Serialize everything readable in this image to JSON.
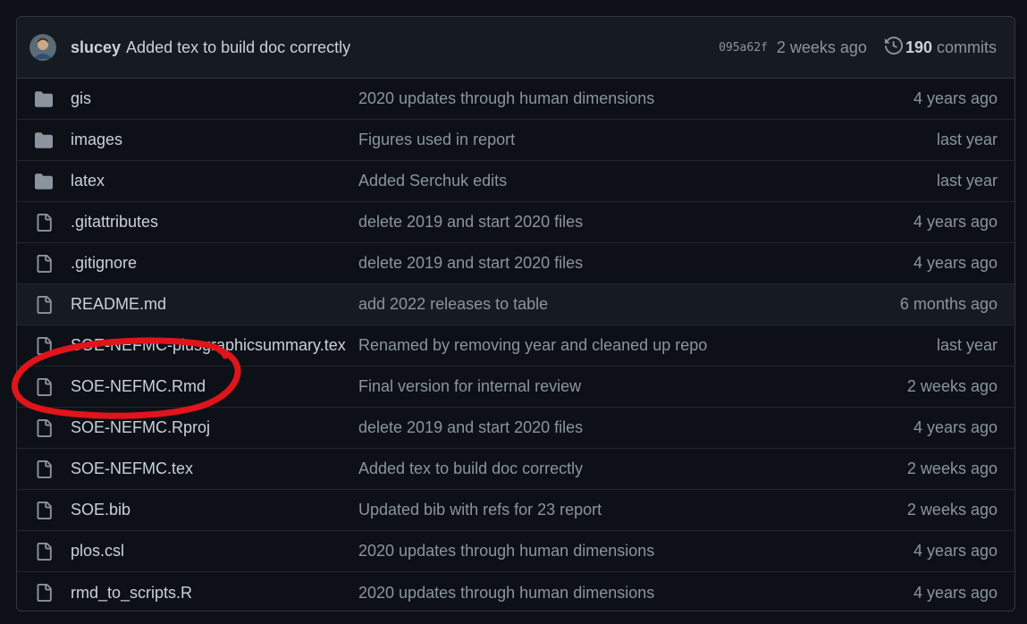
{
  "commit": {
    "author": "slucey",
    "message": "Added tex to build doc correctly",
    "sha": "095a62f",
    "time": "2 weeks ago",
    "commit_count": "190",
    "commits_label": "commits"
  },
  "files": [
    {
      "type": "folder",
      "icon": "folder-icon",
      "name": "gis",
      "message": "2020 updates through human dimensions",
      "time": "4 years ago"
    },
    {
      "type": "folder",
      "icon": "folder-icon",
      "name": "images",
      "message": "Figures used in report",
      "time": "last year"
    },
    {
      "type": "folder",
      "icon": "folder-icon",
      "name": "latex",
      "message": "Added Serchuk edits",
      "time": "last year"
    },
    {
      "type": "file",
      "icon": "file-icon",
      "name": ".gitattributes",
      "message": "delete 2019 and start 2020 files",
      "time": "4 years ago"
    },
    {
      "type": "file",
      "icon": "file-icon",
      "name": ".gitignore",
      "message": "delete 2019 and start 2020 files",
      "time": "4 years ago"
    },
    {
      "type": "file",
      "icon": "file-icon",
      "name": "README.md",
      "message": "add 2022 releases to table",
      "time": "6 months ago"
    },
    {
      "type": "file",
      "icon": "file-icon",
      "name": "SOE-NEFMC-plusgraphicsummary.tex",
      "message": "Renamed by removing year and cleaned up repo",
      "time": "last year"
    },
    {
      "type": "file",
      "icon": "file-icon",
      "name": "SOE-NEFMC.Rmd",
      "message": "Final version for internal review",
      "time": "2 weeks ago"
    },
    {
      "type": "file",
      "icon": "file-icon",
      "name": "SOE-NEFMC.Rproj",
      "message": "delete 2019 and start 2020 files",
      "time": "4 years ago"
    },
    {
      "type": "file",
      "icon": "file-icon",
      "name": "SOE-NEFMC.tex",
      "message": "Added tex to build doc correctly",
      "time": "2 weeks ago"
    },
    {
      "type": "file",
      "icon": "file-icon",
      "name": "SOE.bib",
      "message": "Updated bib with refs for 23 report",
      "time": "2 weeks ago"
    },
    {
      "type": "file",
      "icon": "file-icon",
      "name": "plos.csl",
      "message": "2020 updates through human dimensions",
      "time": "4 years ago"
    },
    {
      "type": "file",
      "icon": "file-icon",
      "name": "rmd_to_scripts.R",
      "message": "2020 updates through human dimensions",
      "time": "4 years ago"
    }
  ],
  "colors": {
    "background": "#0d1117",
    "header_background": "#161b22",
    "border": "#30363d",
    "annotation": "#e0141b"
  }
}
